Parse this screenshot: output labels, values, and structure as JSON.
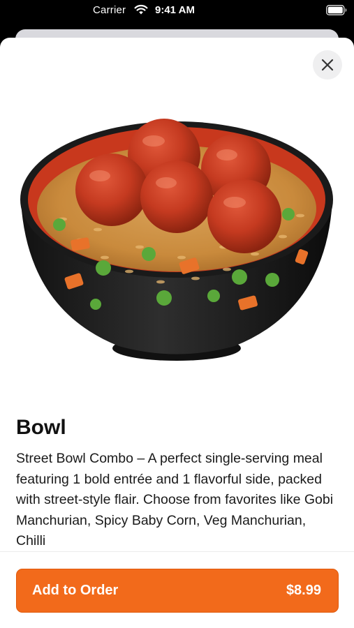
{
  "status_bar": {
    "carrier": "Carrier",
    "time": "9:41 AM",
    "wifi_icon": "wifi-icon",
    "battery_icon": "battery-icon"
  },
  "sheet": {
    "close_icon": "close-icon"
  },
  "product": {
    "image_icon": "rice-bowl-with-manchurian-balls",
    "title": "Bowl",
    "description": "Street Bowl Combo – A perfect single-serving meal featuring 1 bold entrée and 1 flavorful side, packed with street-style flair. Choose from favorites like Gobi Manchurian, Spicy Baby Corn, Veg Manchurian, Chilli"
  },
  "footer": {
    "add_label": "Add to Order",
    "price": "$8.99"
  },
  "colors": {
    "accent": "#f26a1b",
    "accent_border": "#e05a0c",
    "title_text": "#111111",
    "body_text": "#1a1a1a"
  }
}
